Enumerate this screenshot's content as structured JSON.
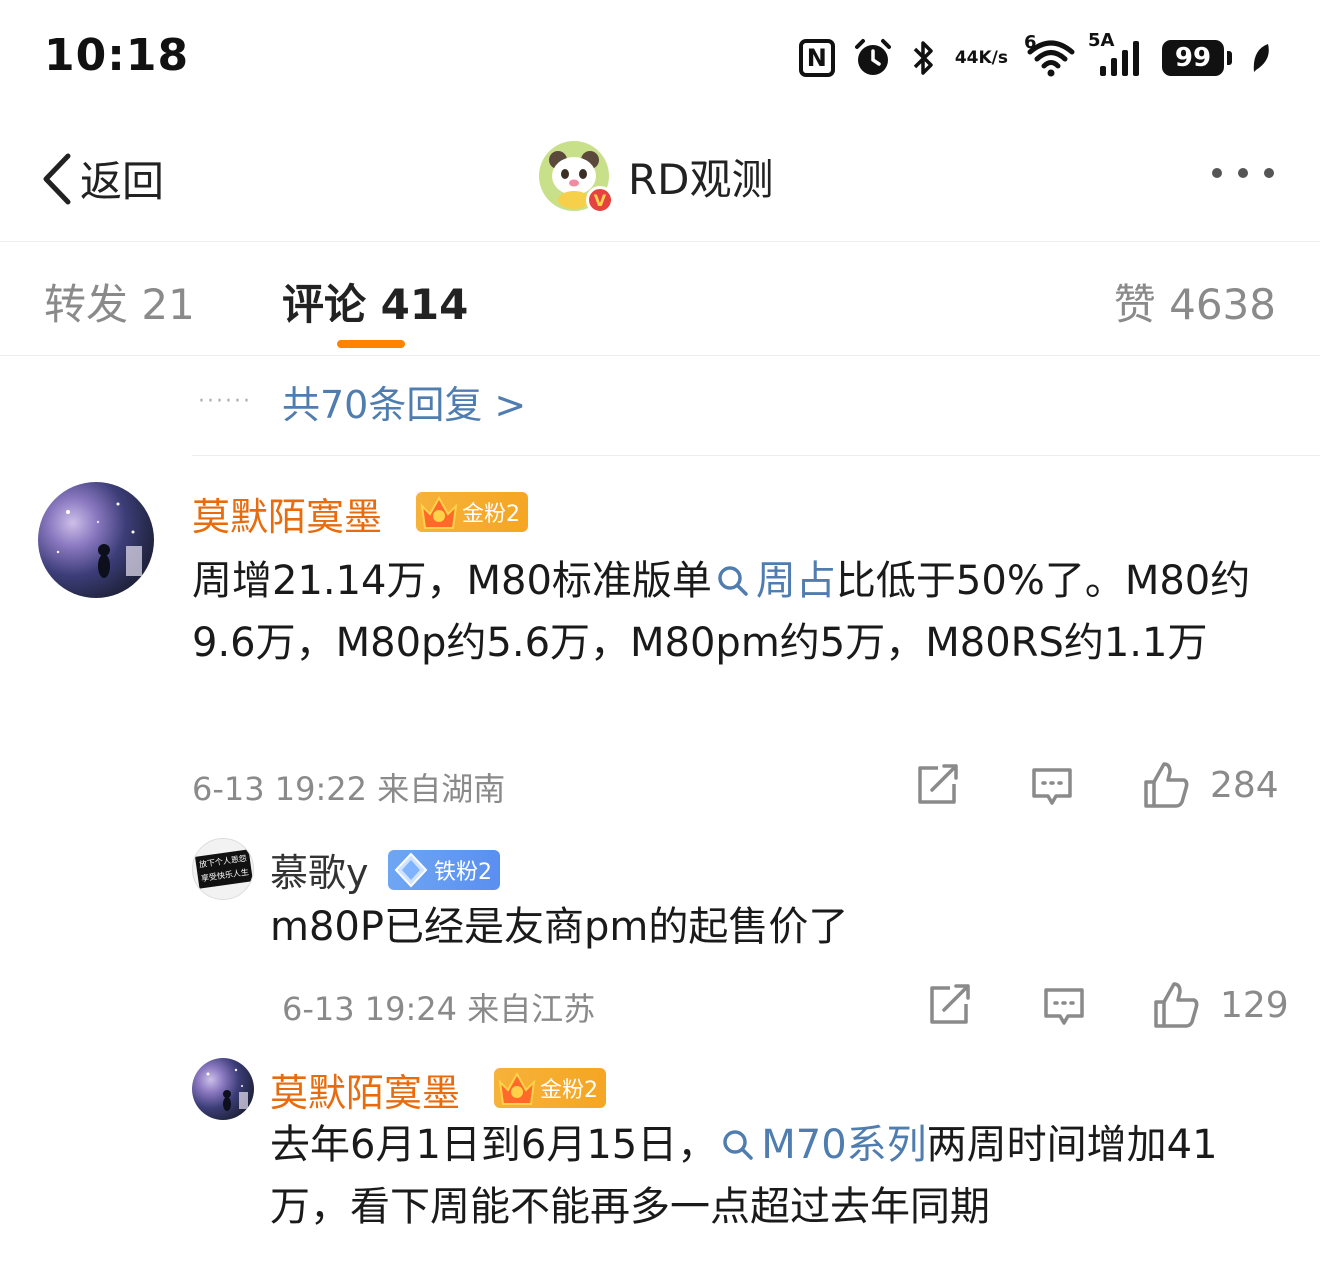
{
  "status_bar": {
    "time": "10:18",
    "nfc": "N",
    "net_speed_top": "44",
    "net_speed_bottom": "K/s",
    "wifi_badge": "6",
    "signal_label": "5A",
    "battery": "99"
  },
  "nav": {
    "back_label": "返回",
    "title": "RD观测",
    "verified_mark": "V"
  },
  "tabs": {
    "forward": "转发 21",
    "comments": "评论 414",
    "likes": "赞 4638"
  },
  "more_replies": {
    "dots": "······",
    "label": "共70条回复 >"
  },
  "comment": {
    "user": "莫默陌寞墨",
    "badge": "金粉2",
    "text_part1": "周增21.14万，M80标准版单",
    "topic": "周占",
    "text_part2": "比低于50%了。M80约9.6万，M80p约5.6万，M80pm约5万，M80RS约1.1万",
    "meta": "6-13 19:22 来自湖南",
    "likes": "284"
  },
  "replies": [
    {
      "user": "慕歌y",
      "badge": "铁粉2",
      "avatar_text_1": "放下个人恩怨",
      "avatar_text_2": "享受快乐人生",
      "text": "m80P已经是友商pm的起售价了",
      "meta": "6-13 19:24 来自江苏",
      "likes": "129"
    },
    {
      "user": "莫默陌寞墨",
      "badge": "金粉2",
      "text_part1": "去年6月1日到6月15日，",
      "topic": "M70系列",
      "text_part2": "两周时间增加41万，看下周能不能再多一点超过去年同期"
    }
  ],
  "colors": {
    "accent": "#ff8200",
    "username": "#e86b0e",
    "link": "#507daf",
    "muted": "#8a8a8a"
  }
}
